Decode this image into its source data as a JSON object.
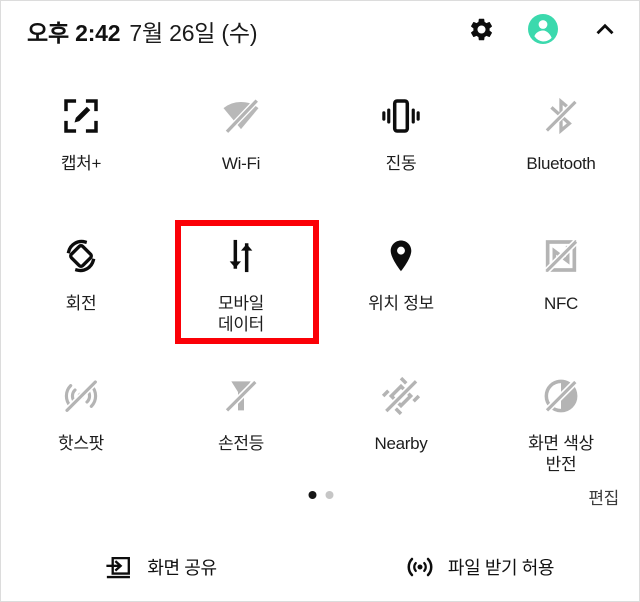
{
  "header": {
    "time": "오후 2:42",
    "date": "7월 26일 (수)",
    "settings_icon": "gear-icon",
    "avatar_icon": "user-avatar-icon",
    "collapse_icon": "chevron-up-icon",
    "avatar_color": "#3BD9AD"
  },
  "tiles": [
    {
      "label": "캡처+",
      "icon": "capture-plus-icon",
      "state": "on"
    },
    {
      "label": "Wi-Fi",
      "icon": "wifi-off-icon",
      "state": "off"
    },
    {
      "label": "진동",
      "icon": "vibrate-icon",
      "state": "on"
    },
    {
      "label": "Bluetooth",
      "icon": "bluetooth-off-icon",
      "state": "off"
    },
    {
      "label": "회전",
      "icon": "auto-rotate-icon",
      "state": "on"
    },
    {
      "label": "모바일\n데이터",
      "icon": "mobile-data-icon",
      "state": "on"
    },
    {
      "label": "위치 정보",
      "icon": "location-pin-icon",
      "state": "on"
    },
    {
      "label": "NFC",
      "icon": "nfc-off-icon",
      "state": "off"
    },
    {
      "label": "핫스팟",
      "icon": "hotspot-off-icon",
      "state": "off"
    },
    {
      "label": "손전등",
      "icon": "flashlight-off-icon",
      "state": "off"
    },
    {
      "label": "Nearby",
      "icon": "nearby-off-icon",
      "state": "off"
    },
    {
      "label": "화면 색상\n반전",
      "icon": "color-invert-off-icon",
      "state": "off"
    }
  ],
  "highlight": {
    "tile_index": 5,
    "color": "#FB0007"
  },
  "pager": {
    "total_pages": 2,
    "active_page": 1,
    "edit_label": "편집"
  },
  "bottom_bar": {
    "items": [
      {
        "label": "화면 공유",
        "icon": "screen-share-icon"
      },
      {
        "label": "파일 받기 허용",
        "icon": "file-receive-icon"
      }
    ]
  }
}
